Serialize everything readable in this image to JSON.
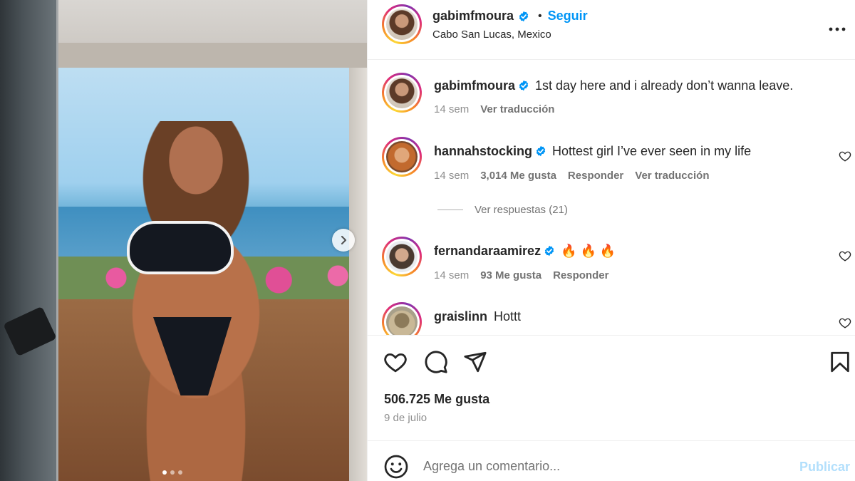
{
  "post": {
    "author": "gabimfmoura",
    "follow_separator": "•",
    "follow_label": "Seguir",
    "location": "Cabo San Lucas, Mexico",
    "more_label": "•••",
    "carousel_next_icon": "chevron-right-icon",
    "likes": "506.725 Me gusta",
    "date": "9 de julio"
  },
  "caption": {
    "user": "gabimfmoura",
    "text": "1st day here and i already don’t wanna leave.",
    "time": "14 sem",
    "translate": "Ver traducción"
  },
  "comments": [
    {
      "user": "hannahstocking",
      "text": "Hottest girl I’ve ever seen in my life",
      "time": "14 sem",
      "likes": "3,014 Me gusta",
      "reply": "Responder",
      "translate": "Ver traducción",
      "view_replies": "Ver respuestas (21)"
    },
    {
      "user": "fernandaraamirez",
      "text": "🔥 🔥 🔥",
      "time": "14 sem",
      "likes": "93 Me gusta",
      "reply": "Responder"
    },
    {
      "user": "graislinn",
      "text": "Hottt"
    }
  ],
  "composer": {
    "placeholder": "Agrega un comentario...",
    "publish_label": "Publicar"
  },
  "colors": {
    "accent_blue": "#0095f6",
    "publish_disabled": "#b2dffc",
    "verified_blue": "#0095f6",
    "flame": "#f4511e"
  }
}
